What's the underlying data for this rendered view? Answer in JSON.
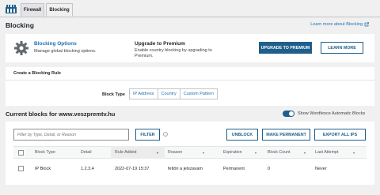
{
  "colors": {
    "accent": "#2271b1",
    "primary_button": "#1f5f8b",
    "background": "#f0f0f1"
  },
  "tabs": [
    {
      "label": "Firewall"
    },
    {
      "label": "Blocking"
    }
  ],
  "header": {
    "title": "Blocking",
    "learn_more": "Learn more about Blocking",
    "learn_more_icon": "external-link-icon"
  },
  "options": {
    "title": "Blocking Options",
    "description": "Manage global blocking options.",
    "upgrade_title": "Upgrade to Premium",
    "upgrade_desc": "Enable country blocking by upgrading to Premium.",
    "upgrade_button": "UPGRADE TO PREMIUM",
    "learn_button": "LEARN MORE"
  },
  "create_rule": {
    "title": "Create a Blocking Rule",
    "block_type_label": "Block Type",
    "types": [
      "IP Address",
      "Country",
      "Custom Pattern"
    ]
  },
  "current": {
    "title": "Current blocks for www.veszpremtv.hu",
    "toggle_label": "Show Wordfence Automatic Blocks",
    "toggle_on": true,
    "filter_placeholder": "Filter by Type, Detail, or Reason",
    "filter_button": "FILTER",
    "unblock_button": "UNBLOCK",
    "make_permanent_button": "MAKE PERMANENT",
    "export_button": "EXPORT ALL IPS",
    "columns": [
      "Block Type",
      "Detail",
      "Rule Added",
      "Reason",
      "Expiration",
      "Block Count",
      "Last Attempt"
    ],
    "rows": [
      {
        "type": "IP Block",
        "detail": "1.2.3.4",
        "added": "2022-07-19 15:37",
        "reason": "feltöri a jelszavam",
        "expiration": "Permanent",
        "count": "0",
        "last": "Never"
      }
    ]
  }
}
